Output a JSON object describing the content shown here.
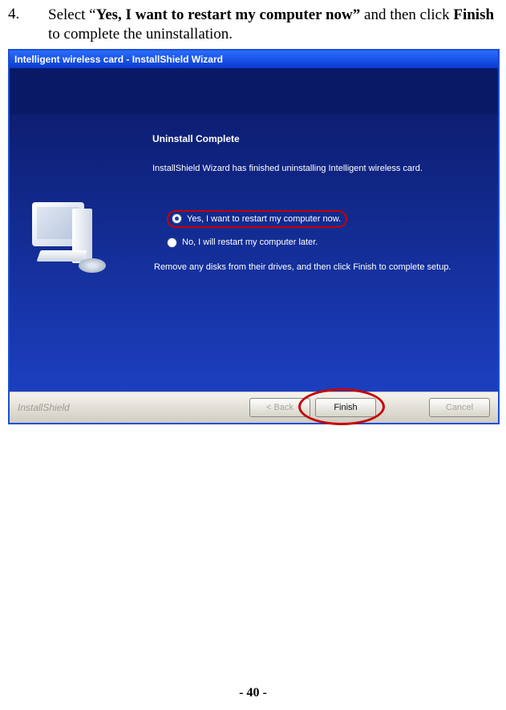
{
  "step": {
    "number": "4.",
    "prefix": "Select “",
    "highlight1": "Yes, I want to restart my computer now”",
    "mid": " and then click ",
    "highlight2": "Finish",
    "suffix": " to complete the uninstallation."
  },
  "window": {
    "title": "Intelligent wireless card - InstallShield Wizard",
    "heading": "Uninstall Complete",
    "description": "InstallShield Wizard has finished uninstalling Intelligent wireless card.",
    "radio_yes": "Yes, I want to restart my computer now.",
    "radio_no": "No, I will restart my computer later.",
    "note": "Remove any disks from their drives, and then click Finish to complete setup.",
    "brand": "InstallShield",
    "buttons": {
      "back": "< Back",
      "finish": "Finish",
      "cancel": "Cancel"
    }
  },
  "page_number": "- 40 -"
}
